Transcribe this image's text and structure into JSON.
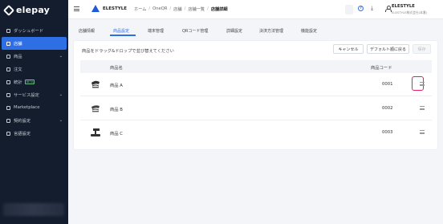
{
  "sidebar": {
    "logo_text": "elepay",
    "items": [
      {
        "label": "ダッシュボード",
        "active": false,
        "chevron": false,
        "icon": "dashboard-icon"
      },
      {
        "label": "店舗",
        "active": true,
        "chevron": false,
        "icon": "store-icon"
      },
      {
        "label": "商品",
        "active": false,
        "chevron": true,
        "icon": "product-icon"
      },
      {
        "label": "注文",
        "active": false,
        "chevron": false,
        "icon": "order-icon"
      },
      {
        "label": "統計",
        "active": false,
        "chevron": false,
        "icon": "stats-icon",
        "badge": "BETA"
      },
      {
        "label": "サービス設定",
        "active": false,
        "chevron": true,
        "icon": "service-icon"
      },
      {
        "label": "Marketplace",
        "active": false,
        "chevron": false,
        "icon": "marketplace-icon"
      },
      {
        "label": "契約設定",
        "active": false,
        "chevron": true,
        "icon": "contract-icon"
      },
      {
        "label": "言語設定",
        "active": false,
        "chevron": false,
        "icon": "language-icon"
      }
    ]
  },
  "topbar": {
    "brand": "ELESTYLE",
    "breadcrumbs": [
      "ホーム",
      "OneQR",
      "店舗",
      "店舗一覧",
      "店舗詳細"
    ],
    "user_name": "ELESTYLE",
    "user_sub": "ELESTYLE株式会社(本番)"
  },
  "tabs": [
    "店舗情報",
    "商品設定",
    "端末管理",
    "QRコード管理",
    "詳細設定",
    "決済方法管理",
    "機能設定"
  ],
  "active_tab": "商品設定",
  "card": {
    "description": "商品をドラッグ&ドロップで並び替えてください",
    "cancel_label": "キャンセル",
    "reset_label": "デフォルト順に戻る",
    "save_label": "保存"
  },
  "table": {
    "headers": {
      "name": "商品名",
      "code": "商品コード"
    },
    "rows": [
      {
        "name": "商品 A",
        "code": "0001"
      },
      {
        "name": "商品 B",
        "code": "0002"
      },
      {
        "name": "商品 C",
        "code": "0003"
      }
    ]
  },
  "colors": {
    "sidebar_bg": "#141d2d",
    "accent": "#2f6fe6",
    "highlight": "#e3235f"
  }
}
